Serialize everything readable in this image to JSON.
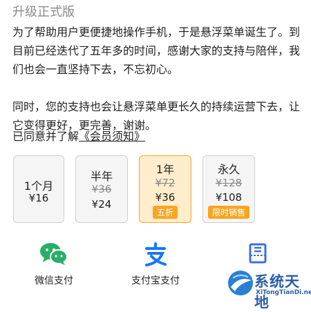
{
  "header": {
    "title": "升级正式版"
  },
  "intro": {
    "paragraph1": "为了帮助用户更便捷地操作手机，于是悬浮菜单诞生了。到目前已经迭代了五年多的时间，感谢大家的支持与陪伴，我们也会一直坚持下去，不忘初心。",
    "paragraph2": "同时，您的支持也会让悬浮菜单更长久的持续运营下去，让它变得更好，更完善，谢谢。"
  },
  "agreement": {
    "prefix": "已同意并了解",
    "link": "《会员须知》"
  },
  "plans": [
    {
      "name": "1个月",
      "price": "¥16"
    },
    {
      "name": "半年",
      "original_price": "¥36",
      "price": "¥24"
    },
    {
      "name": "1年",
      "original_price": "¥72",
      "price": "¥36",
      "tag": "五折",
      "selected": true
    },
    {
      "name": "永久",
      "original_price": "¥128",
      "price": "¥108",
      "tag": "限时销售"
    }
  ],
  "payment": [
    {
      "label": "微信支付",
      "icon": "wechat-pay-icon",
      "color": "#2aae67"
    },
    {
      "label": "支付宝支付",
      "icon": "alipay-icon",
      "color": "#1677ff"
    },
    {
      "label": "",
      "icon": "card-icon",
      "color": "#3a6ee8"
    }
  ],
  "watermark": {
    "name": "系统天地",
    "url": "XiTongTianDi.net"
  },
  "colors": {
    "accent": "#f6a623",
    "selected_bg": "#ffedcc",
    "muted": "#8a8a8a"
  }
}
